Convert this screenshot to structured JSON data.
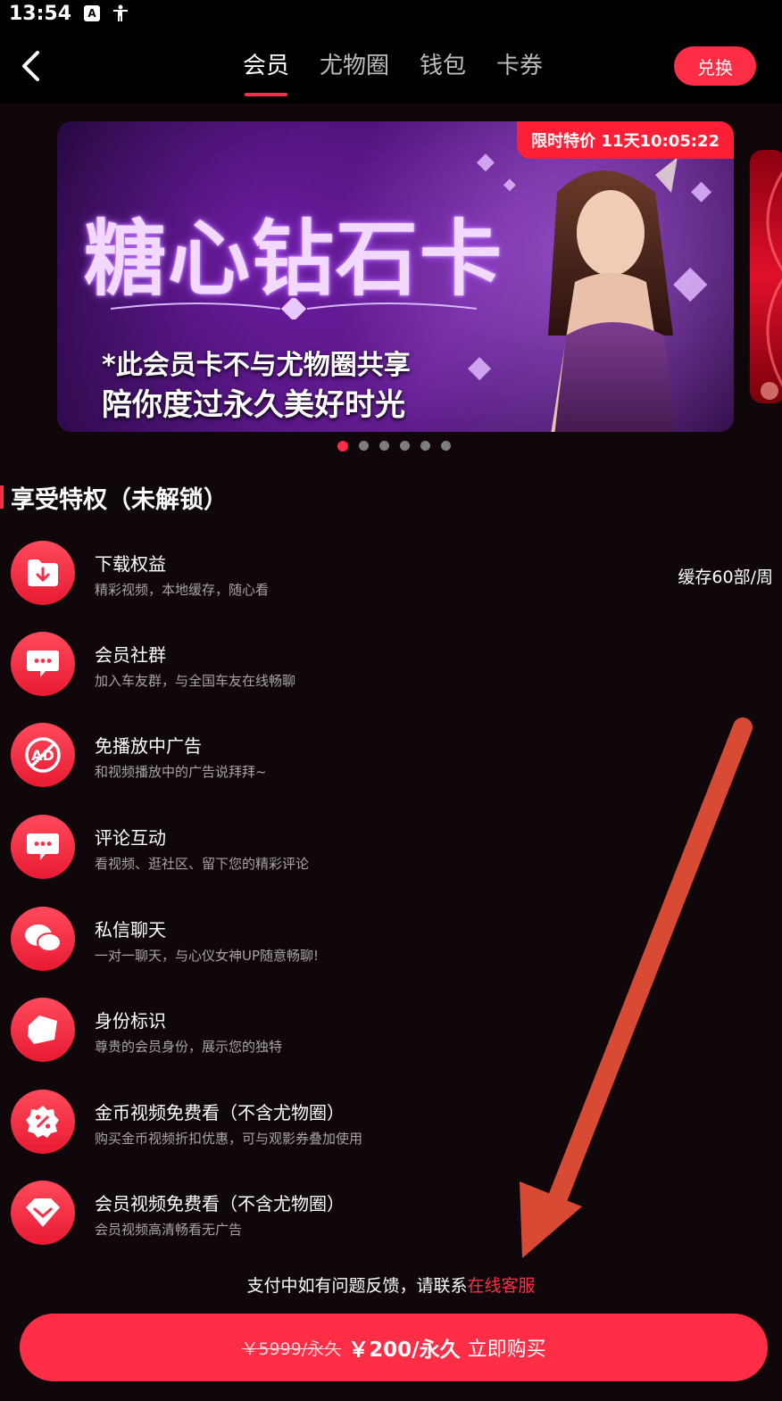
{
  "status_bar": {
    "time": "13:54",
    "icons": [
      "a-notification-icon",
      "accessibility-icon"
    ]
  },
  "header": {
    "tabs": [
      {
        "label": "会员",
        "active": true
      },
      {
        "label": "尤物圈",
        "active": false
      },
      {
        "label": "钱包",
        "active": false
      },
      {
        "label": "卡券",
        "active": false
      }
    ],
    "exchange_label": "兑换"
  },
  "banner": {
    "title": "糖心钻石卡",
    "subtitle1": "*此会员卡不与尤物圈共享",
    "subtitle2": "陪你度过永久美好时光",
    "promo_tag": "限时特价 11天10:05:22",
    "dots_total": 6,
    "active_dot": 1
  },
  "section": {
    "title": "享受特权（未解锁）"
  },
  "perks": [
    {
      "title": "下载权益",
      "desc": "精彩视频，本地缓存，随心看",
      "extra": "缓存60部/周",
      "icon": "download-folder-icon"
    },
    {
      "title": "会员社群",
      "desc": "加入车友群，与全国车友在线畅聊",
      "extra": "",
      "icon": "chat-bubble-icon"
    },
    {
      "title": "免播放中广告",
      "desc": "和视频播放中的广告说拜拜~",
      "extra": "",
      "icon": "no-ad-icon"
    },
    {
      "title": "评论互动",
      "desc": "看视频、逛社区、留下您的精彩评论",
      "extra": "",
      "icon": "comment-icon"
    },
    {
      "title": "私信聊天",
      "desc": "一对一聊天，与心仪女神UP随意畅聊!",
      "extra": "",
      "icon": "private-message-icon"
    },
    {
      "title": "身份标识",
      "desc": "尊贵的会员身份，展示您的独特",
      "extra": "",
      "icon": "badge-icon"
    },
    {
      "title": "金币视频免费看（不含尤物圈）",
      "desc": "购买金币视频折扣优惠，可与观影券叠加使用",
      "extra": "",
      "icon": "discount-icon"
    },
    {
      "title": "会员视频免费看（不含尤物圈）",
      "desc": "会员视频高清畅看无广告",
      "extra": "",
      "icon": "diamond-icon"
    }
  ],
  "support": {
    "text": "支付中如有问题反馈，请联系",
    "link": "在线客服"
  },
  "purchase": {
    "old_price": "￥5999/永久",
    "new_price": "￥200/永久",
    "action": "立即购买"
  },
  "colors": {
    "accent": "#ff2d45",
    "background": "#0f0709",
    "annotation_arrow": "#d84a33"
  }
}
